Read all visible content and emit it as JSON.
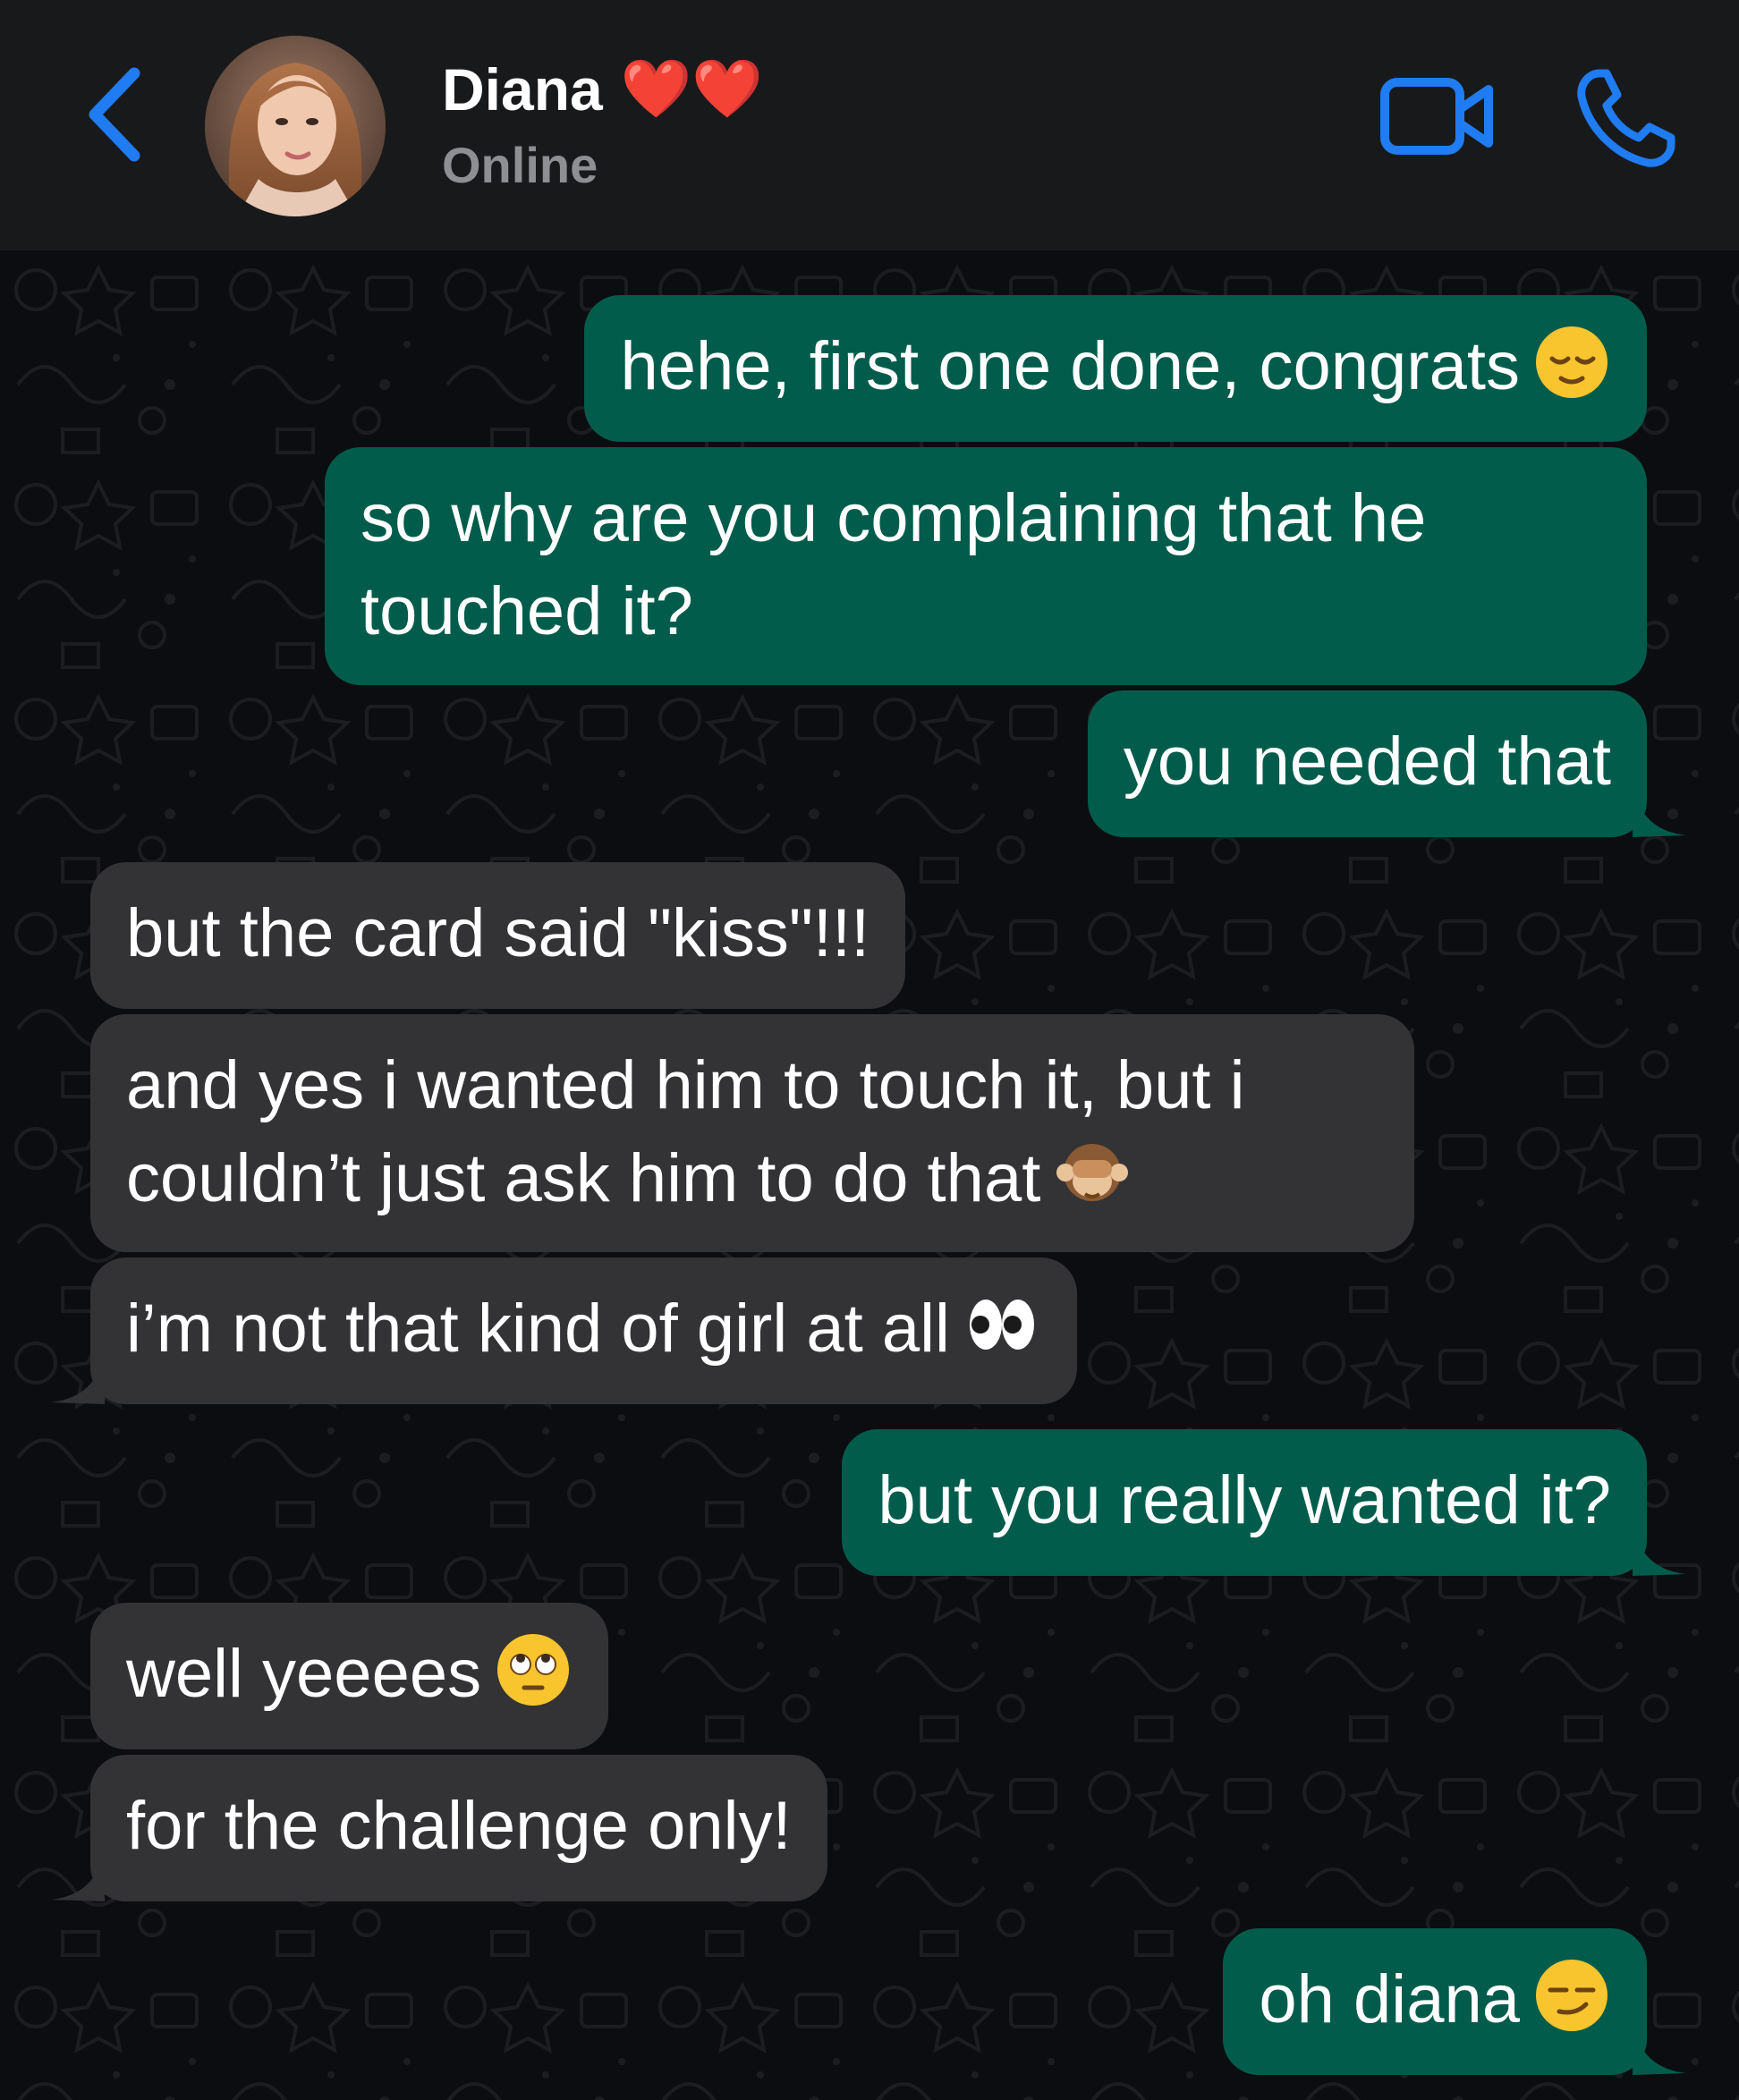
{
  "header": {
    "contact_name": "Diana",
    "name_emoji": "❤️❤️",
    "status": "Online",
    "back_icon": "chevron-left-icon",
    "video_icon": "video-camera-icon",
    "call_icon": "phone-icon",
    "accent_color": "#1f7cf2"
  },
  "messages": [
    {
      "direction": "outgoing",
      "text": "hehe, first one done, congrats",
      "emoji": "relieved-face-emoji"
    },
    {
      "direction": "outgoing",
      "lines": [
        "so why are you complaining that he",
        "touched it?"
      ]
    },
    {
      "direction": "outgoing",
      "text": "you needed that"
    },
    {
      "direction": "incoming",
      "text": "but the card said \"kiss\"!!!"
    },
    {
      "direction": "incoming",
      "lines": [
        "and yes i wanted him to touch it, but i",
        "couldn’t just ask him to do that"
      ],
      "emoji": "see-no-evil-monkey-emoji"
    },
    {
      "direction": "incoming",
      "text": "i’m not that kind of girl at all",
      "emoji": "eyes-emoji"
    },
    {
      "direction": "outgoing",
      "text": "but you really wanted it?"
    },
    {
      "direction": "incoming",
      "text": "well yeeees",
      "emoji": "rolling-eyes-face-emoji"
    },
    {
      "direction": "incoming",
      "text": "for the challenge only!"
    },
    {
      "direction": "outgoing",
      "text": "oh diana",
      "emoji": "smirking-face-emoji"
    }
  ],
  "colors": {
    "header_bg": "#18191b",
    "chat_bg": "#0c0d10",
    "outgoing_bubble": "#025c4b",
    "incoming_bubble": "#333335",
    "status_text": "#8d8f93"
  }
}
